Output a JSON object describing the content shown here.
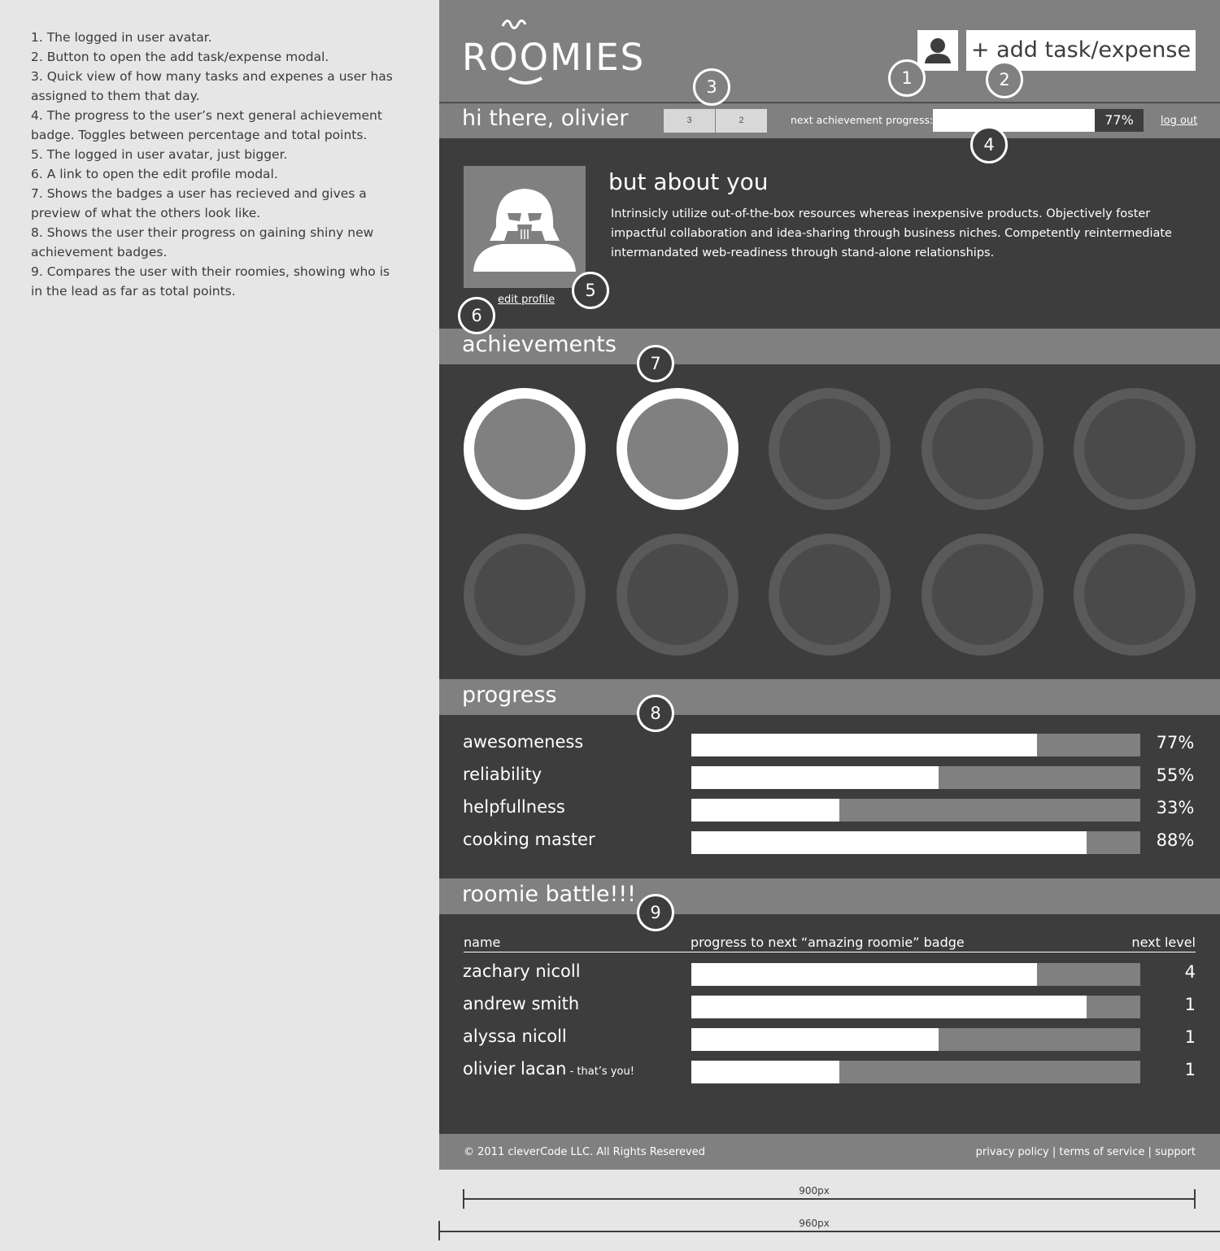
{
  "notes": [
    "1. The logged in user avatar.",
    "2. Button to open the add task/expense modal.",
    "3. Quick view of how many tasks and expenes a user has assigned to them that day.",
    "4. The progress to the user’s next general achievement badge. Toggles between percentage and total points.",
    "5. The logged in user avatar, just bigger.",
    "6. A link to open the edit profile modal.",
    "7. Shows the badges a user has recieved and gives a preview of what the others look like.",
    "8. Shows the user their progress on gaining shiny new achievement badges.",
    "9. Compares the user with their roomies, showing who is in the lead as far as total points."
  ],
  "header": {
    "logo": "ROOMIES",
    "add_button": "+ add task/expense"
  },
  "subheader": {
    "greeting": "hi there, olivier",
    "tasks_count": "3",
    "expenses_count": "2",
    "next_achievement_label": "next achievement progress:",
    "next_achievement_progress": 77,
    "next_achievement_pct": "77%",
    "logout": "log out"
  },
  "about": {
    "title": "but about you",
    "body": "Intrinsicly utilize out-of-the-box resources whereas inexpensive products. Objectively foster impactful collaboration and idea-sharing through business niches. Competently reintermediate intermandated web-readiness through stand-alone relationships.",
    "edit_profile": "edit profile"
  },
  "achievements": {
    "title": "achievements",
    "badges": [
      {
        "earned": true
      },
      {
        "earned": true
      },
      {
        "earned": false
      },
      {
        "earned": false
      },
      {
        "earned": false
      },
      {
        "earned": false
      },
      {
        "earned": false
      },
      {
        "earned": false
      },
      {
        "earned": false
      },
      {
        "earned": false
      }
    ]
  },
  "progress": {
    "title": "progress",
    "rows": [
      {
        "label": "awesomeness",
        "value": 77,
        "pct": "77%"
      },
      {
        "label": "reliability",
        "value": 55,
        "pct": "55%"
      },
      {
        "label": "helpfullness",
        "value": 33,
        "pct": "33%"
      },
      {
        "label": "cooking master",
        "value": 88,
        "pct": "88%"
      }
    ]
  },
  "battle": {
    "title": "roomie battle!!!",
    "col_name": "name",
    "col_progress": "progress to next “amazing roomie” badge",
    "col_level": "next level",
    "rows": [
      {
        "name": "zachary nicoll",
        "suffix": "",
        "value": 77,
        "level": "4"
      },
      {
        "name": "andrew smith",
        "suffix": "",
        "value": 88,
        "level": "1"
      },
      {
        "name": "alyssa nicoll",
        "suffix": "",
        "value": 55,
        "level": "1"
      },
      {
        "name": "olivier lacan",
        "suffix": " - that’s you!",
        "value": 33,
        "level": "1"
      }
    ]
  },
  "footer": {
    "copyright": "© 2011 cleverCode LLC. All Rights Resereved",
    "privacy": "privacy policy",
    "terms": "terms of service",
    "support": "support",
    "separator": "|"
  },
  "callouts": [
    "1",
    "2",
    "3",
    "4",
    "5",
    "6",
    "7",
    "8",
    "9"
  ],
  "rulers": {
    "inner": "900px",
    "outer": "960px"
  },
  "colors": {
    "mid_gray": "#808080",
    "dark_gray": "#3d3d3d",
    "page_bg": "#e6e6e6",
    "white": "#ffffff"
  },
  "icons": {
    "user_avatar": "user-silhouette-icon",
    "profile_avatar": "darth-vader-avatar"
  }
}
